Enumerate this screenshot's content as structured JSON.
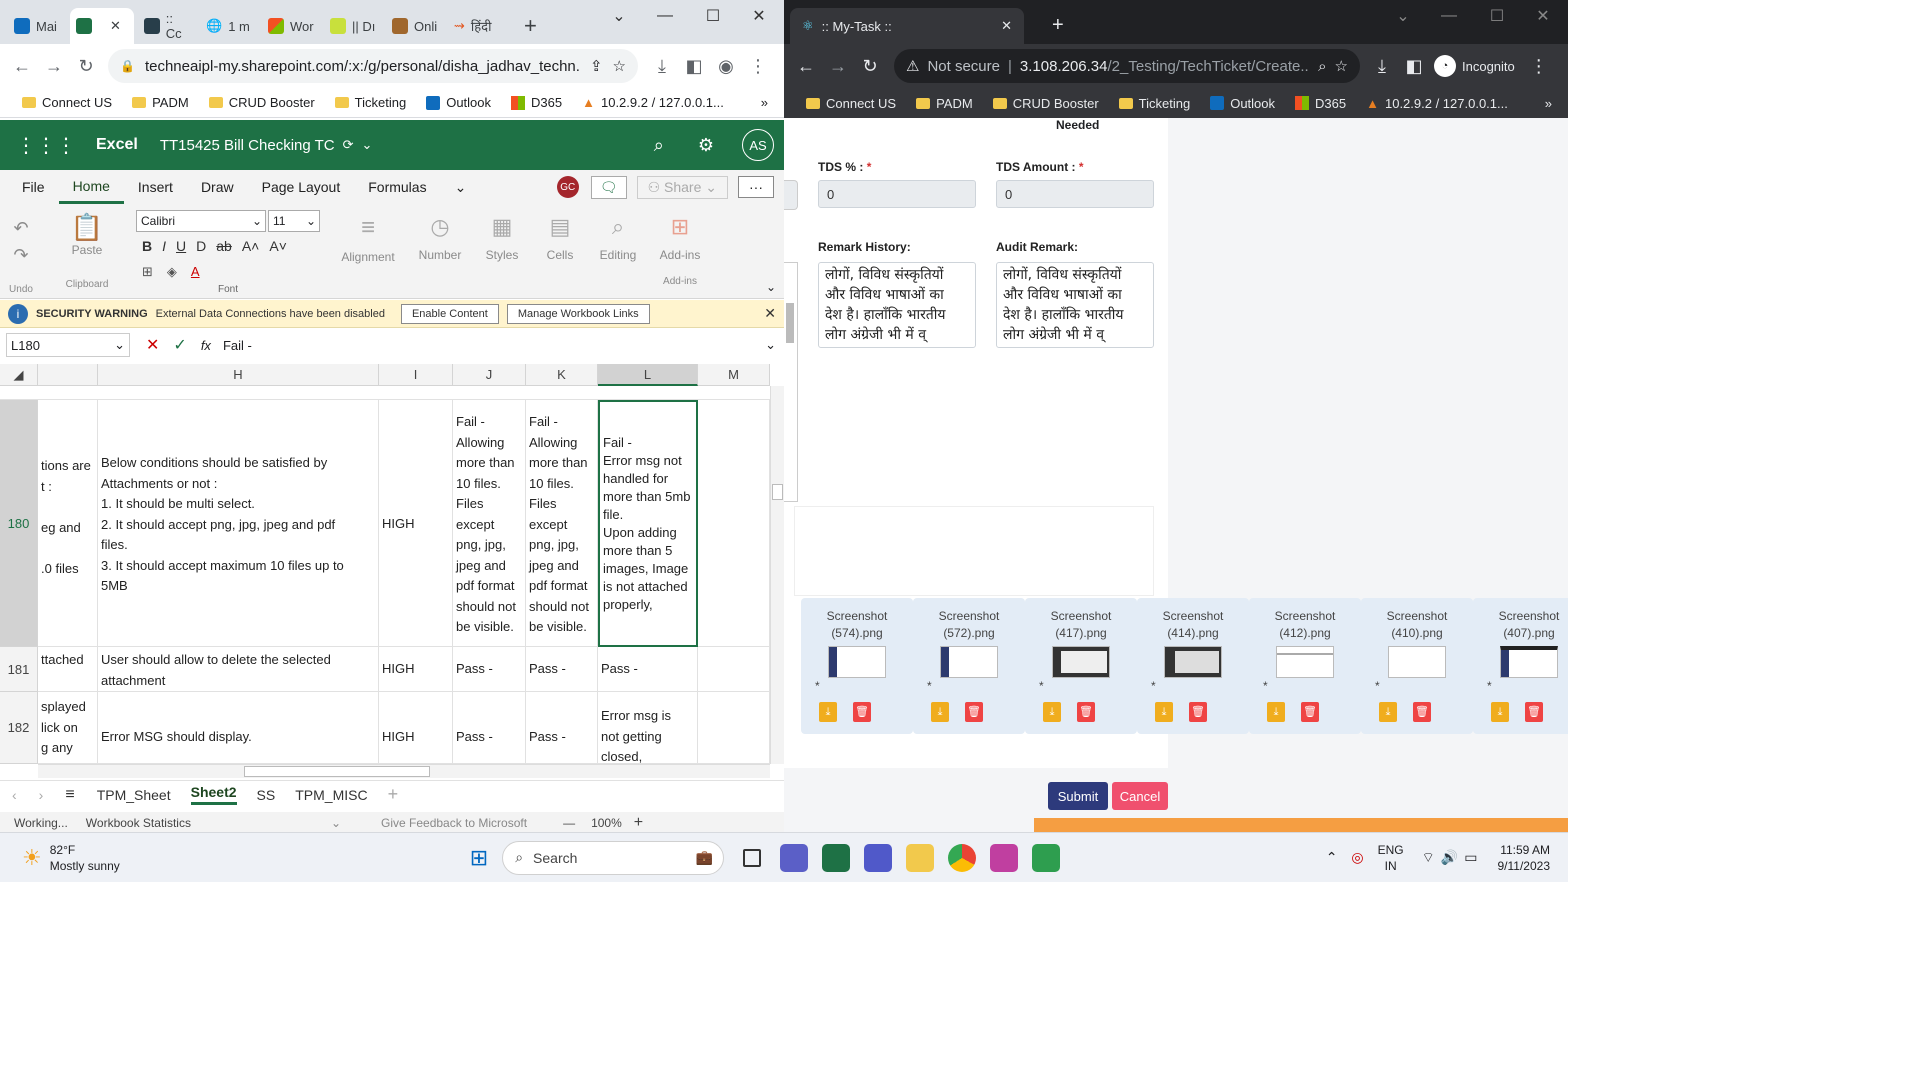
{
  "left_browser": {
    "tabs": [
      "Mai",
      "",
      ":: Cc",
      "1 m",
      "Wor",
      "|| Dı",
      "Onli",
      "हिंदी"
    ],
    "new_tab": "+",
    "url": "techneaipl-my.sharepoint.com/:x:/g/personal/disha_jadhav_techn...",
    "bookmarks": [
      "Connect US",
      "PADM",
      "CRUD Booster",
      "Ticketing",
      "Outlook",
      "D365",
      "10.2.9.2 / 127.0.0.1..."
    ],
    "more": "»"
  },
  "excel": {
    "app": "Excel",
    "file_title": "TT15425 Bill Checking TC",
    "avatar": "AS",
    "ribbon_tabs": [
      "File",
      "Home",
      "Insert",
      "Draw",
      "Page Layout",
      "Formulas"
    ],
    "coauthor": "GC",
    "share": "Share",
    "font_name": "Calibri",
    "font_size": "11",
    "groups": {
      "undo": "Undo",
      "clipboard": "Clipboard",
      "paste": "Paste",
      "font": "Font",
      "alignment": "Alignment",
      "number": "Number",
      "styles": "Styles",
      "cells": "Cells",
      "editing": "Editing",
      "addins": "Add-ins",
      "addins_group": "Add-ins"
    },
    "security": {
      "title": "SECURITY WARNING",
      "message": "External Data Connections have been disabled",
      "enable": "Enable Content",
      "manage": "Manage Workbook Links"
    },
    "name_box": "L180",
    "formula": "Fail  -",
    "columns": [
      "H",
      "I",
      "J",
      "K",
      "L",
      "M"
    ],
    "rows": [
      {
        "num": "180",
        "g": "tions are\nt :\n\neg and\n\n.0 files",
        "h": "Below conditions should be satisfied by\nAttachments or not :\n1. It should be multi select.\n2. It should accept png, jpg, jpeg and pdf\nfiles.\n3. It should accept maximum 10 files up to\n5MB",
        "i": "HIGH",
        "j": "Fail -\nAllowing\nmore than\n10 files.\nFiles\nexcept\npng, jpg,\njpeg and\npdf format\nshould not\nbe visible.",
        "k": "Fail -\nAllowing\nmore than\n10 files.\nFiles\nexcept\npng, jpg,\njpeg and\npdf format\nshould not\nbe visible.",
        "l": "Fail  -\nError msg not\nhandled for\nmore than 5mb\nfile.\nUpon adding\nmore than 5\nimages, Image\nis not attached\nproperly,"
      },
      {
        "num": "181",
        "g": "ttached",
        "h": "User should allow to delete the selected\nattachment",
        "i": "HIGH",
        "j": "Pass -",
        "k": "Pass -",
        "l": "Pass -"
      },
      {
        "num": "182",
        "g": "splayed\nlick on\ng any",
        "h": "Error MSG should display.",
        "i": "HIGH",
        "j": "Pass -",
        "k": "Pass -",
        "l": "Error msg is\nnot getting\nclosed,"
      }
    ],
    "sheets": [
      "TPM_Sheet",
      "Sheet2",
      "SS",
      "TPM_MISC"
    ],
    "add_sheet": "+",
    "status": {
      "state": "Working...",
      "stats": "Workbook Statistics",
      "feedback": "Give Feedback to Microsoft",
      "zoom": "100%"
    }
  },
  "right_browser": {
    "tab_title": ":: My-Task ::",
    "not_secure": "Not secure",
    "url_host": "3.108.206.34",
    "url_path": "/2_Testing/TechTicket/Create...",
    "incognito": "Incognito",
    "bookmarks": [
      "Connect US",
      "PADM",
      "CRUD Booster",
      "Ticketing",
      "Outlook",
      "D365",
      "10.2.9.2 / 127.0.0.1..."
    ],
    "more": "»"
  },
  "form": {
    "needed": "Needed",
    "tds_percent_label": "TDS % :",
    "tds_amount_label": "TDS Amount :",
    "required_mark": "*",
    "tds_percent": "0",
    "tds_amount": "0",
    "remark_history_label": "Remark History:",
    "audit_remark_label": "Audit Remark:",
    "remark_text": "लोगों, विविध संस्कृतियों और विविध भाषाओं का देश है। हालाँकि भारतीय लोग अंग्रेजी भी में व्",
    "audit_text": "लोगों, विविध संस्कृतियों और विविध भाषाओं का देश है। हालाँकि भारतीय लोग अंग्रेजी भी में व्",
    "attachments": [
      {
        "name": "Screenshot\n(574).png",
        "star": "*"
      },
      {
        "name": "Screenshot\n(572).png",
        "star": "*"
      },
      {
        "name": "Screenshot\n(417).png",
        "star": "*"
      },
      {
        "name": "Screenshot\n(414).png",
        "star": "*"
      },
      {
        "name": "Screenshot\n(412).png",
        "star": "*"
      },
      {
        "name": "Screenshot\n(410).png",
        "star": "*"
      },
      {
        "name": "Screenshot\n(407).png",
        "star": "*"
      }
    ],
    "submit": "Submit",
    "cancel": "Cancel"
  },
  "taskbar": {
    "temp": "82°F",
    "weather": "Mostly sunny",
    "search": "Search",
    "lang1": "ENG",
    "lang2": "IN",
    "time": "11:59 AM",
    "date": "9/11/2023"
  }
}
